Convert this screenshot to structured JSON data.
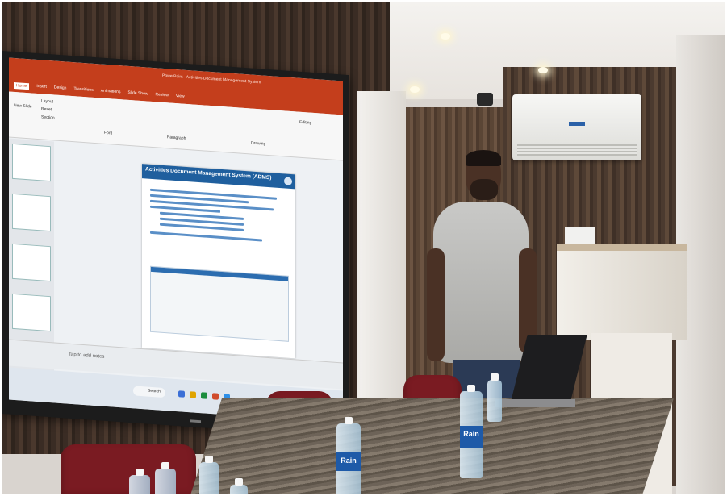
{
  "screen": {
    "app_title": "PowerPoint · Activities Document Management System",
    "ribbon_tabs": [
      "Home",
      "Insert",
      "Design",
      "Transitions",
      "Animations",
      "Slide Show",
      "Review",
      "View"
    ],
    "ribbon_groups": [
      "Layout",
      "Reset",
      "Section",
      "New Slide",
      "Font",
      "Paragraph",
      "Drawing",
      "Editing"
    ],
    "slide_title": "Activities Document Management System (ADMS)",
    "notes_placeholder": "Tap to add notes",
    "taskbar_search": "Search"
  },
  "bottle_brand": "Rain",
  "colors": {
    "ppt_ribbon": "#c43e1c",
    "slide_header": "#1f5f9e",
    "chair": "#7a1b22",
    "wall_wood": "#4a382d"
  }
}
